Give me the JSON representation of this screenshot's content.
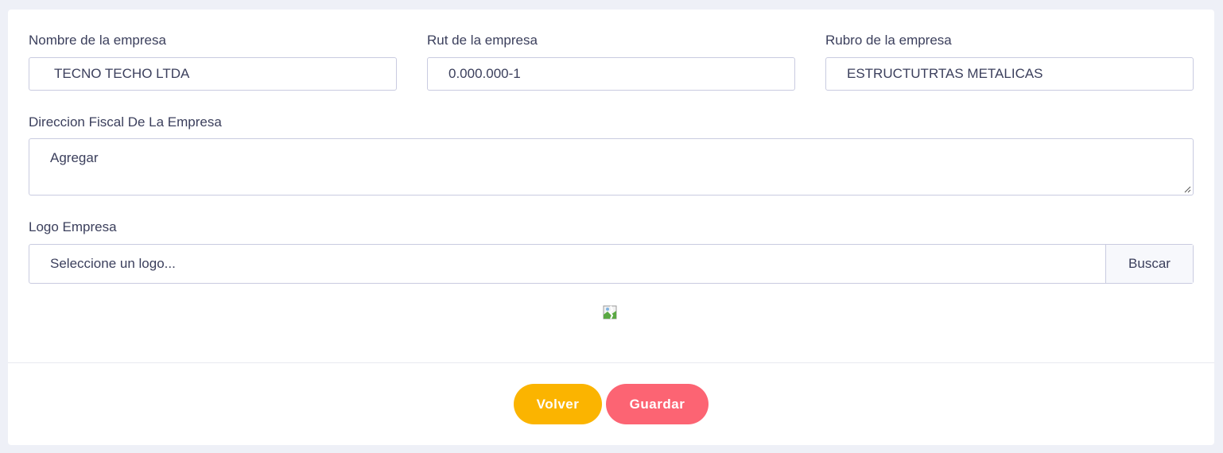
{
  "form": {
    "company_name": {
      "label": "Nombre de la empresa",
      "value": "TECNO TECHO LTDA"
    },
    "company_rut": {
      "label": "Rut de la empresa",
      "value": "0.000.000-1"
    },
    "company_sector": {
      "label": "Rubro de la empresa",
      "value": "ESTRUCTUTRTAS METALICAS"
    },
    "fiscal_address": {
      "label": "Direccion Fiscal De La Empresa",
      "value": "Agregar"
    },
    "logo": {
      "label": "Logo Empresa",
      "placeholder": "Seleccione un logo...",
      "browse_label": "Buscar",
      "preview_icon": "broken-image-icon"
    }
  },
  "actions": {
    "back_label": "Volver",
    "save_label": "Guardar"
  },
  "colors": {
    "back_button": "#fbb400",
    "save_button": "#fc6473",
    "text": "#3b3f5c",
    "border": "#c9cbe0",
    "page_background": "#eef0f7"
  }
}
